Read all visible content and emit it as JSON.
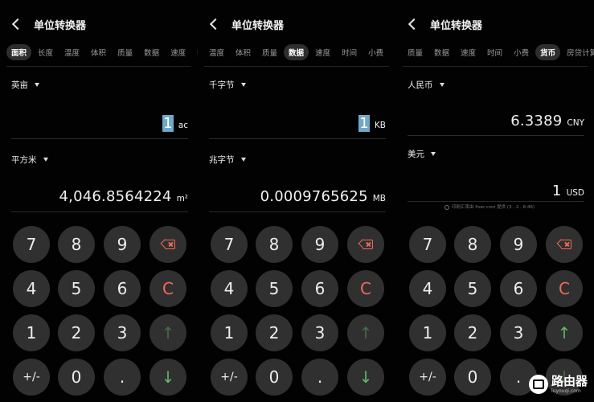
{
  "panels": [
    {
      "title": "单位转换器",
      "tabs": [
        "面积",
        "长度",
        "温度",
        "体积",
        "质量",
        "数据",
        "速度",
        "时"
      ],
      "active_tab": 0,
      "from_unit": "英亩",
      "from_value": "1",
      "from_symbol": "ac",
      "to_unit": "平方米",
      "to_value": "4,046.8564224",
      "to_symbol": "m²"
    },
    {
      "title": "单位转换器",
      "tabs": [
        "温度",
        "体积",
        "质量",
        "数据",
        "速度",
        "时间",
        "小费"
      ],
      "active_tab": 3,
      "from_unit": "千字节",
      "from_value": "1",
      "from_symbol": "KB",
      "to_unit": "兆字节",
      "to_value": "0.0009765625",
      "to_symbol": "MB"
    },
    {
      "title": "单位转换器",
      "tabs": [
        "质量",
        "数据",
        "速度",
        "时间",
        "小费",
        "货币",
        "房贷计算"
      ],
      "active_tab": 5,
      "from_unit": "人民币",
      "from_value": "6.3389",
      "from_symbol": "CNY",
      "to_unit": "美元",
      "to_value": "1",
      "to_symbol": "USD",
      "notice": "印刷汇率由 fixer.com 提供 (3 . 2 . 8:46)"
    }
  ],
  "keypad": {
    "k7": "7",
    "k8": "8",
    "k9": "9",
    "k4": "4",
    "k5": "5",
    "k6": "6",
    "clear": "C",
    "k1": "1",
    "k2": "2",
    "k3": "3",
    "up": "↑",
    "sign": "+/-",
    "k0": "0",
    "dot": ".",
    "down": "↓"
  },
  "watermark": {
    "name": "路由器",
    "domain": "luyouqi.com"
  },
  "colors": {
    "accent_red": "#ef6a5b",
    "accent_green": "#60b764",
    "key_bg": "#303030",
    "selection": "#6fa9c9"
  }
}
